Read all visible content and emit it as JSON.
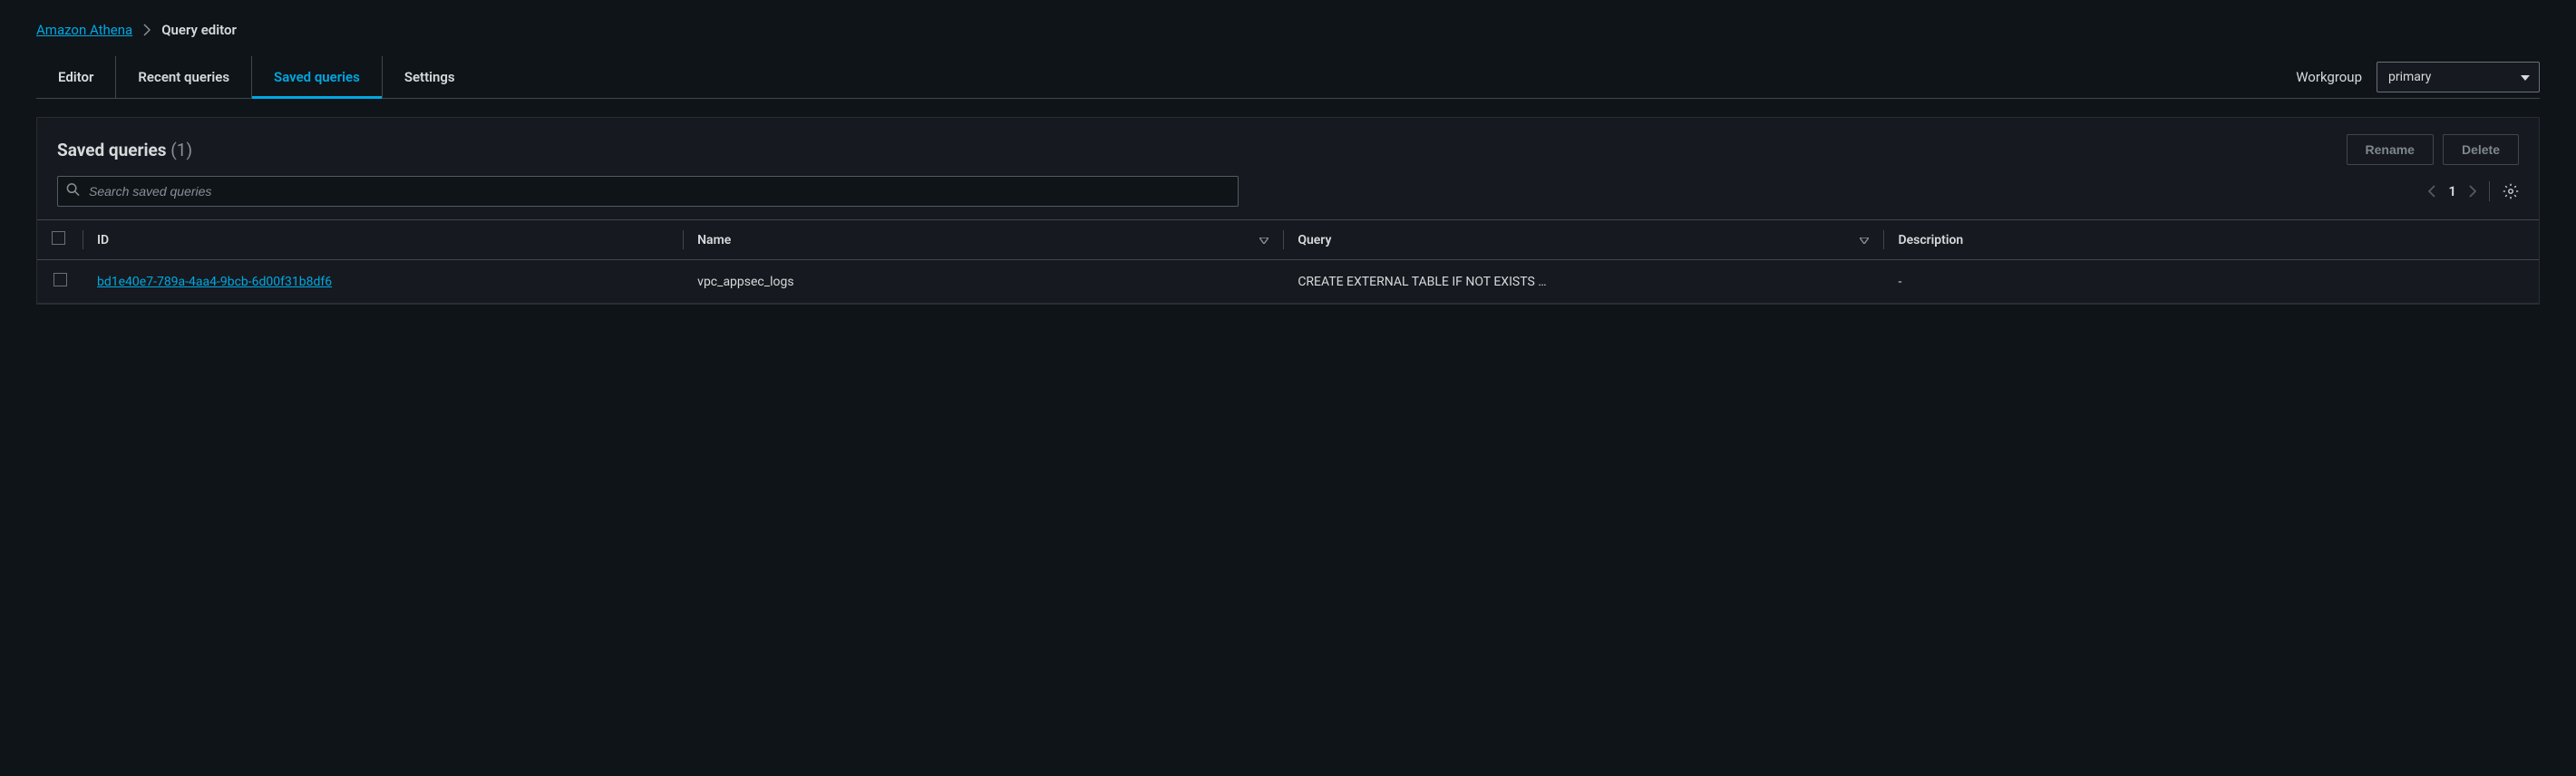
{
  "breadcrumb": {
    "root": "Amazon Athena",
    "current": "Query editor"
  },
  "tabs": {
    "editor": "Editor",
    "recent": "Recent queries",
    "saved": "Saved queries",
    "settings": "Settings"
  },
  "workgroup": {
    "label": "Workgroup",
    "selected": "primary"
  },
  "panel": {
    "title": "Saved queries",
    "count": "(1)",
    "rename_btn": "Rename",
    "delete_btn": "Delete",
    "search_placeholder": "Search saved queries"
  },
  "pagination": {
    "page": "1"
  },
  "table": {
    "headers": {
      "id": "ID",
      "name": "Name",
      "query": "Query",
      "description": "Description"
    },
    "rows": [
      {
        "id": "bd1e40e7-789a-4aa4-9bcb-6d00f31b8df6",
        "name": "vpc_appsec_logs",
        "query": "CREATE EXTERNAL TABLE IF NOT EXISTS …",
        "description": "-"
      }
    ]
  }
}
